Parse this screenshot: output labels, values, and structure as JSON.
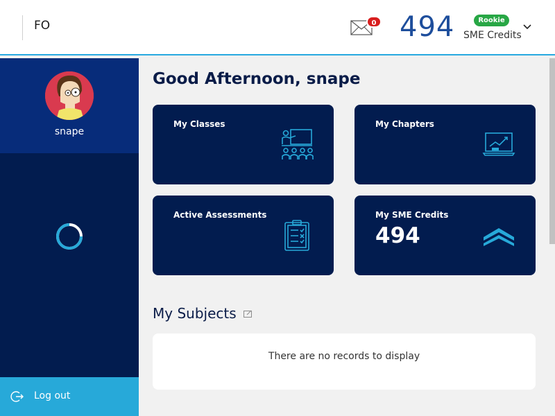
{
  "header": {
    "brand": "FO",
    "mail_count": "0",
    "credits_value": "494",
    "rank_badge": "Rookie",
    "credits_label": "SME Credits"
  },
  "sidebar": {
    "username": "snape",
    "logout_label": "Log out"
  },
  "main": {
    "greeting": "Good Afternoon, snape",
    "cards": [
      {
        "title": "My Classes",
        "icon": "classroom-teacher-icon"
      },
      {
        "title": "My Chapters",
        "icon": "laptop-chart-icon"
      },
      {
        "title": "Active Assessments",
        "icon": "clipboard-checklist-icon"
      },
      {
        "title": "My SME Credits",
        "value": "494",
        "icon": "rank-chevron-icon"
      }
    ],
    "subjects_title": "My Subjects",
    "subjects_empty": "There are no records to display"
  },
  "colors": {
    "navy": "#021c4f",
    "profile_blue": "#072c7a",
    "accent_cyan": "#27a9d9",
    "badge_red": "#d81e1e",
    "badge_green": "#28a745",
    "credits_blue": "#1e4e9c"
  }
}
